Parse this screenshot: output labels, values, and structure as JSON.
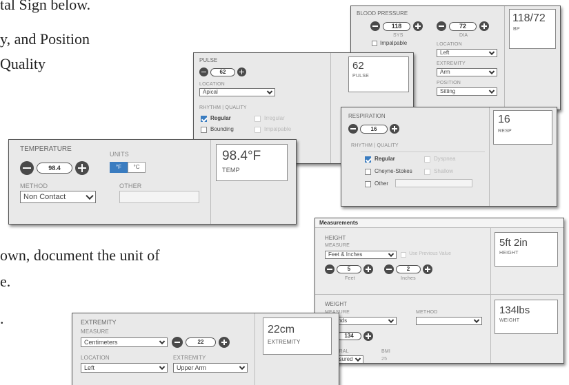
{
  "text": {
    "line1": "tal Sign below.",
    "line2": "y, and Position",
    "line3": "Quality",
    "line4": "own, document the unit of",
    "line5": "e.",
    "line6": "."
  },
  "bp": {
    "title": "BLOOD PRESSURE",
    "sys_value": "118",
    "sys_label": "SYS",
    "dia_value": "72",
    "dia_label": "DIA",
    "impalpable": "Impalpable",
    "location_label": "LOCATION",
    "location_value": "Left",
    "extremity_label": "EXTREMITY",
    "extremity_value": "Arm",
    "position_label": "POSITION",
    "position_value": "Sitting",
    "display_value": "118/72",
    "display_label": "BP"
  },
  "pulse": {
    "title": "PULSE",
    "value": "62",
    "location_label": "LOCATION",
    "location_value": "Apical",
    "rhythm_label": "RHYTHM | QUALITY",
    "opt_regular": "Regular",
    "opt_irregular": "Irregular",
    "opt_bounding": "Bounding",
    "opt_impalpable": "Impalpable",
    "display_value": "62",
    "display_label": "PULSE"
  },
  "resp": {
    "title": "RESPIRATION",
    "value": "16",
    "rhythm_label": "RHYTHM | QUALITY",
    "opt_regular": "Regular",
    "opt_dyspnea": "Dyspnea",
    "opt_cheyne": "Cheyne-Stokes",
    "opt_shallow": "Shallow",
    "opt_other": "Other",
    "display_value": "16",
    "display_label": "RESP"
  },
  "temp": {
    "title": "TEMPERATURE",
    "value": "98.4",
    "units_label": "UNITS",
    "unit_f": "°F",
    "unit_c": "°C",
    "method_label": "METHOD",
    "method_value": "Non Contact",
    "other_label": "OTHER",
    "display_value": "98.4°F",
    "display_label": "TEMP"
  },
  "meas": {
    "header": "Measurements",
    "height_title": "HEIGHT",
    "measure_label": "MEASURE",
    "height_measure": "Feet & Inches",
    "use_previous": "Use Previous Value",
    "feet_value": "5",
    "feet_label": "Feet",
    "inches_value": "2",
    "inches_label": "Inches",
    "height_display": "5ft 2in",
    "height_display_label": "HEIGHT",
    "weight_title": "WEIGHT",
    "weight_measure_label": "MEASURE",
    "weight_measure": "Pounds",
    "method_label": "METHOD",
    "weight_value": "134",
    "general_label": "GENERAL",
    "general_value": "Measured",
    "bmi_label": "BMI",
    "bmi_value": "25",
    "weight_display": "134lbs",
    "weight_display_label": "WEIGHT"
  },
  "ext": {
    "title": "EXTREMITY",
    "measure_label": "MEASURE",
    "measure_value": "Centimeters",
    "value": "22",
    "location_label": "LOCATION",
    "location_value": "Left",
    "extremity_label": "EXTREMITY",
    "extremity_value": "Upper Arm",
    "display_value": "22cm",
    "display_label": "EXTREMITY"
  },
  "colors": {
    "accent": "#3a7cc0",
    "panel_bg": "#e9e9e9",
    "button": "#4a4a4a"
  },
  "icons": [
    "minus-circle-icon",
    "plus-circle-icon",
    "chevron-down-icon",
    "checkbox-icon"
  ]
}
